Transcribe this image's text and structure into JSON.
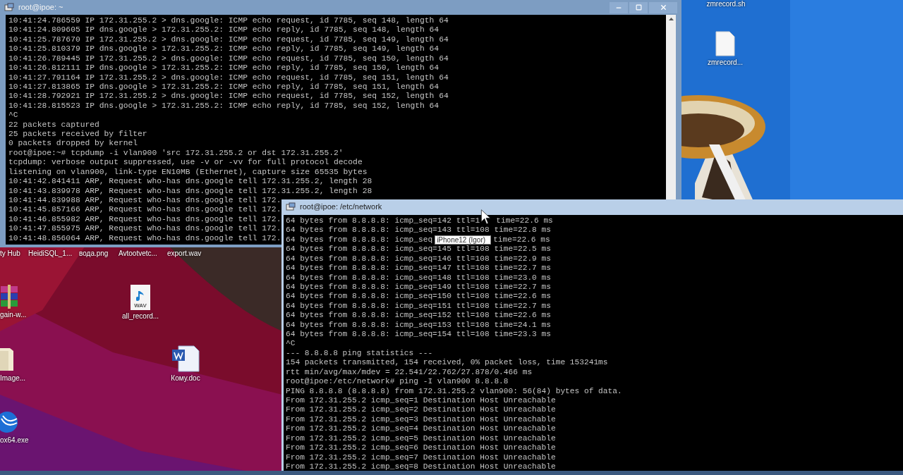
{
  "top_window": {
    "title": "root@ipoe: ~",
    "active": false,
    "lines": [
      "10:41:24.786559 IP 172.31.255.2 > dns.google: ICMP echo request, id 7785, seq 148, length 64",
      "10:41:24.809605 IP dns.google > 172.31.255.2: ICMP echo reply, id 7785, seq 148, length 64",
      "10:41:25.787670 IP 172.31.255.2 > dns.google: ICMP echo request, id 7785, seq 149, length 64",
      "10:41:25.810379 IP dns.google > 172.31.255.2: ICMP echo reply, id 7785, seq 149, length 64",
      "10:41:26.789445 IP 172.31.255.2 > dns.google: ICMP echo request, id 7785, seq 150, length 64",
      "10:41:26.812111 IP dns.google > 172.31.255.2: ICMP echo reply, id 7785, seq 150, length 64",
      "10:41:27.791164 IP 172.31.255.2 > dns.google: ICMP echo request, id 7785, seq 151, length 64",
      "10:41:27.813865 IP dns.google > 172.31.255.2: ICMP echo reply, id 7785, seq 151, length 64",
      "10:41:28.792921 IP 172.31.255.2 > dns.google: ICMP echo request, id 7785, seq 152, length 64",
      "10:41:28.815523 IP dns.google > 172.31.255.2: ICMP echo reply, id 7785, seq 152, length 64",
      "^C",
      "22 packets captured",
      "25 packets received by filter",
      "0 packets dropped by kernel",
      "root@ipoe:~# tcpdump -i vlan900 'src 172.31.255.2 or dst 172.31.255.2'",
      "tcpdump: verbose output suppressed, use -v or -vv for full protocol decode",
      "listening on vlan900, link-type EN10MB (Ethernet), capture size 65535 bytes",
      "10:41:42.841411 ARP, Request who-has dns.google tell 172.31.255.2, length 28",
      "10:41:43.839978 ARP, Request who-has dns.google tell 172.31.255.2, length 28",
      "10:41:44.839988 ARP, Request who-has dns.google tell 172.",
      "10:41:45.857166 ARP, Request who-has dns.google tell 172.",
      "10:41:46.855982 ARP, Request who-has dns.google tell 172.",
      "10:41:47.855975 ARP, Request who-has dns.google tell 172.",
      "10:41:48.856064 ARP, Request who-has dns.google tell 172."
    ]
  },
  "bottom_window": {
    "title": "root@ipoe: /etc/network",
    "active": true,
    "lines": [
      {
        "text": "64 bytes from 8.8.8.8: icmp_seq=142 ttl=1",
        "tail": "time=22.6 ms"
      },
      "64 bytes from 8.8.8.8: icmp_seq=143 ttl=108 time=22.8 ms",
      {
        "text": "64 bytes from 8.8.8.8: icmp_seq",
        "tooltip": "iPhone12 (Igor)",
        "tail": "time=22.6 ms"
      },
      "64 bytes from 8.8.8.8: icmp_seq=145 ttl=108 time=22.5 ms",
      "64 bytes from 8.8.8.8: icmp_seq=146 ttl=108 time=22.9 ms",
      "64 bytes from 8.8.8.8: icmp_seq=147 ttl=108 time=22.7 ms",
      "64 bytes from 8.8.8.8: icmp_seq=148 ttl=108 time=23.0 ms",
      "64 bytes from 8.8.8.8: icmp_seq=149 ttl=108 time=22.7 ms",
      "64 bytes from 8.8.8.8: icmp_seq=150 ttl=108 time=22.6 ms",
      "64 bytes from 8.8.8.8: icmp_seq=151 ttl=108 time=22.7 ms",
      "64 bytes from 8.8.8.8: icmp_seq=152 ttl=108 time=22.6 ms",
      "64 bytes from 8.8.8.8: icmp_seq=153 ttl=108 time=24.1 ms",
      "64 bytes from 8.8.8.8: icmp_seq=154 ttl=108 time=23.3 ms",
      "^C",
      "--- 8.8.8.8 ping statistics ---",
      "154 packets transmitted, 154 received, 0% packet loss, time 153241ms",
      "rtt min/avg/max/mdev = 22.541/22.762/27.878/0.466 ms",
      "root@ipoe:/etc/network# ping -I vlan900 8.8.8.8",
      "PING 8.8.8.8 (8.8.8.8) from 172.31.255.2 vlan900: 56(84) bytes of data.",
      "From 172.31.255.2 icmp_seq=1 Destination Host Unreachable",
      "From 172.31.255.2 icmp_seq=2 Destination Host Unreachable",
      "From 172.31.255.2 icmp_seq=3 Destination Host Unreachable",
      "From 172.31.255.2 icmp_seq=4 Destination Host Unreachable",
      "From 172.31.255.2 icmp_seq=5 Destination Host Unreachable",
      "From 172.31.255.2 icmp_seq=6 Destination Host Unreachable",
      "From 172.31.255.2 icmp_seq=7 Destination Host Unreachable",
      "From 172.31.255.2 icmp_seq=8 Destination Host Unreachable"
    ]
  },
  "desktop_icons": [
    {
      "label": "zmrecord.sh",
      "kind": "none"
    },
    {
      "label": "zmrecord...",
      "kind": "file"
    },
    {
      "label": "ty Hub",
      "kind": "none"
    },
    {
      "label": "HeidiSQL_1...",
      "kind": "none"
    },
    {
      "label": "вода.png",
      "kind": "none"
    },
    {
      "label": "Avtootvetc...",
      "kind": "none"
    },
    {
      "label": "export.wav",
      "kind": "none"
    },
    {
      "label": "gain-w...",
      "kind": "archive"
    },
    {
      "label": "all_record...",
      "kind": "audio",
      "icon_text": "WAV"
    },
    {
      "label": "Image...",
      "kind": "folder"
    },
    {
      "label": "Кому.doc",
      "kind": "word"
    },
    {
      "label": "ox64.exe",
      "kind": "app"
    }
  ]
}
